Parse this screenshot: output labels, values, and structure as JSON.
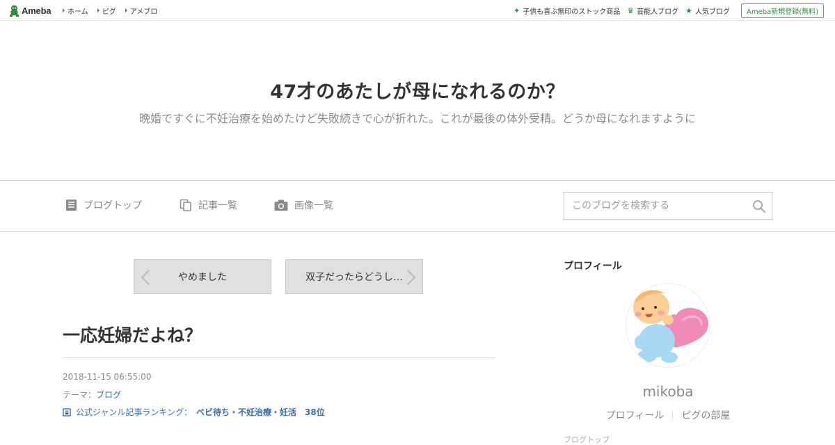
{
  "topbar": {
    "logo_text": "Ameba",
    "nav": [
      "ホーム",
      "ピグ",
      "アメブロ"
    ],
    "right_links": [
      {
        "icon": "sparkle-icon",
        "label": "子供も喜ぶ無印のストック商品"
      },
      {
        "icon": "crown-icon",
        "label": "芸能人ブログ"
      },
      {
        "icon": "star-icon",
        "label": "人気ブログ"
      }
    ],
    "register_label": "Ameba新規登録(無料)"
  },
  "header": {
    "title": "47才のあたしが母になれるのか？",
    "description": "晩婚ですぐに不妊治療を始めたけど失敗続きで心が折れた。これが最後の体外受精。どうか母になれますように"
  },
  "blognav": {
    "items": [
      {
        "icon": "document-icon",
        "label": "ブログトップ"
      },
      {
        "icon": "copy-icon",
        "label": "記事一覧"
      },
      {
        "icon": "camera-icon",
        "label": "画像一覧"
      }
    ],
    "search_placeholder": "このブログを検索する"
  },
  "pager": {
    "prev_label": "やめました",
    "next_label": "双子だったらどうし…"
  },
  "article": {
    "title": "一応妊婦だよね？",
    "date": "2018-11-15 06:55:00",
    "theme_prefix": "テーマ：",
    "theme": "ブログ",
    "ranking_label": "公式ジャンル記事ランキング：",
    "ranking_value": "ベビ待ち・不妊治療・妊活　38位"
  },
  "sidebar": {
    "heading": "プロフィール",
    "username": "mikoba",
    "links": [
      "プロフィール",
      "ピグの部屋"
    ],
    "cut_text": "ブログトップ"
  },
  "colors": {
    "accent_green": "#2d8c3c",
    "link_blue": "#3366aa",
    "pager_bg": "#e0e0e0"
  }
}
